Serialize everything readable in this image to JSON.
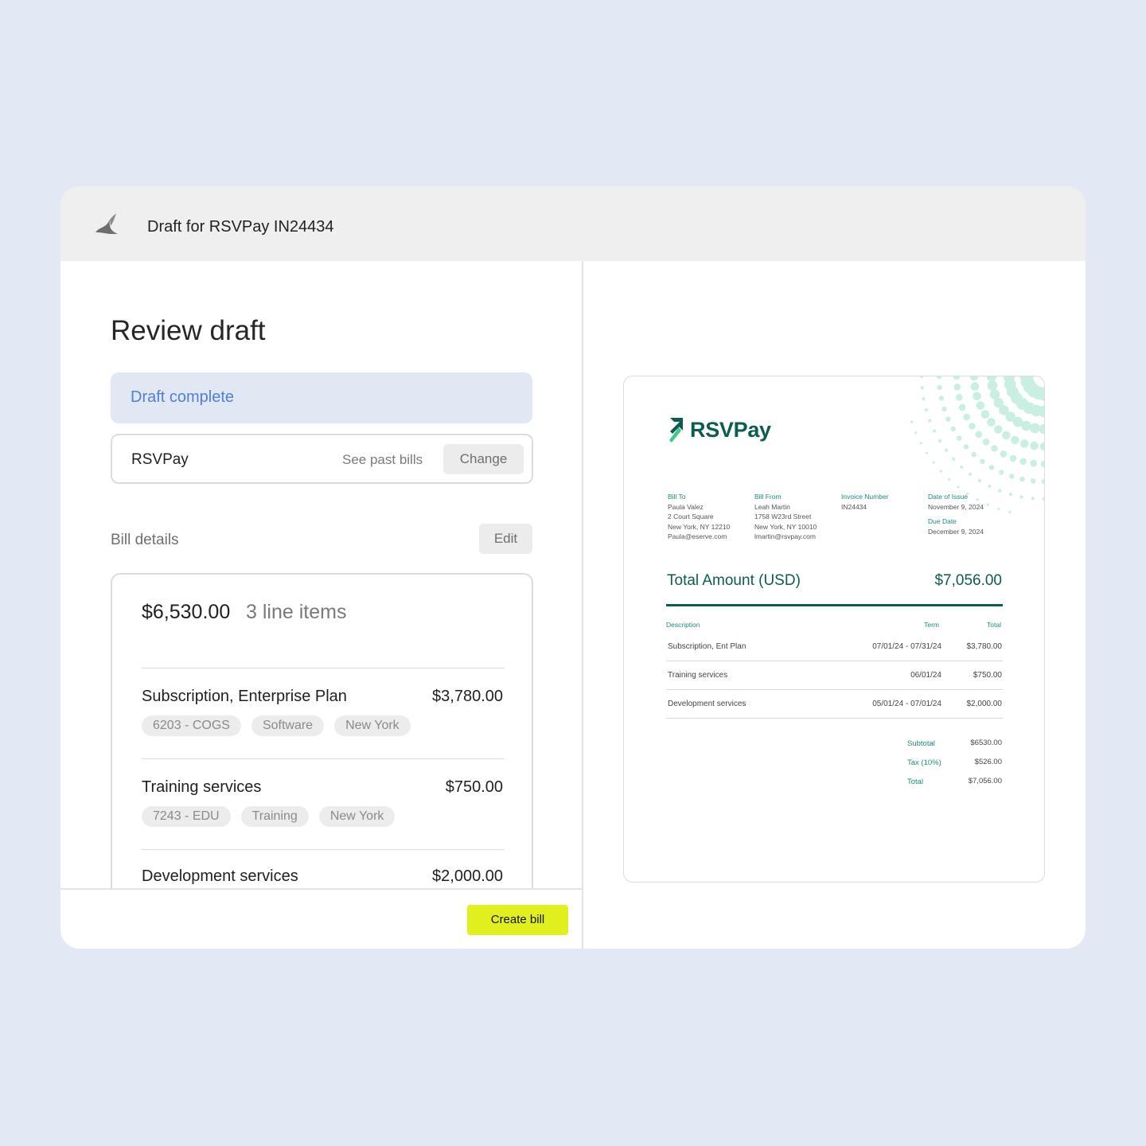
{
  "window": {
    "title": "Draft for RSVPay IN24434",
    "logo_icon": "bird-logo-icon"
  },
  "review": {
    "title": "Review draft",
    "status": "Draft complete",
    "vendor": {
      "name": "RSVPay",
      "past_bills_label": "See past bills",
      "change_label": "Change"
    },
    "section_label": "Bill details",
    "edit_label": "Edit",
    "summary": {
      "total": "$6,530.00",
      "count": "3 line items"
    },
    "line_items": [
      {
        "name": "Subscription, Enterprise Plan",
        "amount": "$3,780.00",
        "tags": [
          "6203 - COGS",
          "Software",
          "New York"
        ]
      },
      {
        "name": "Training services",
        "amount": "$750.00",
        "tags": [
          "7243 - EDU",
          "Training",
          "New York"
        ]
      },
      {
        "name": "Development services",
        "amount": "$2,000.00",
        "tags": []
      }
    ],
    "create_label": "Create bill"
  },
  "invoice": {
    "brand": "RSVPay",
    "brand_icon": "arrow-up-right-icon",
    "bill_to": {
      "label": "Bill To",
      "lines": [
        "Paula Valez",
        "2 Court Square",
        "New York, NY 12210",
        "Paula@eserve.com"
      ]
    },
    "bill_from": {
      "label": "Bill From",
      "lines": [
        "Leah Martin",
        "1758 W23rd Street",
        "New York, NY 10010",
        "lmartin@rsvpay.com"
      ]
    },
    "invoice_number": {
      "label": "Invoice Number",
      "value": "IN24434"
    },
    "date_of_issue": {
      "label": "Date of Issue",
      "value": "November 9, 2024"
    },
    "due_date": {
      "label": "Due Date",
      "value": "December 9, 2024"
    },
    "total_label": "Total Amount (USD)",
    "total_value": "$7,056.00",
    "columns": {
      "description": "Description",
      "term": "Term",
      "total": "Total"
    },
    "rows": [
      {
        "description": "Subscription, Ent Plan",
        "term": "07/01/24 - 07/31/24",
        "total": "$3,780.00"
      },
      {
        "description": "Training services",
        "term": "06/01/24",
        "total": "$750.00"
      },
      {
        "description": "Development services",
        "term": "05/01/24 - 07/01/24",
        "total": "$2,000.00"
      }
    ],
    "subtotal": {
      "label": "Subtotal",
      "value": "$6530.00"
    },
    "tax": {
      "label": "Tax (10%)",
      "value": "$526.00"
    },
    "grand_total": {
      "label": "Total",
      "value": "$7,056.00"
    }
  },
  "colors": {
    "background": "#e2e9f4",
    "accent_button": "#e2ef1e",
    "status_banner": "#e1e8f4",
    "status_text": "#4f7fd4",
    "invoice_brand": "#0d5c52",
    "invoice_label": "#1e8a7c"
  }
}
